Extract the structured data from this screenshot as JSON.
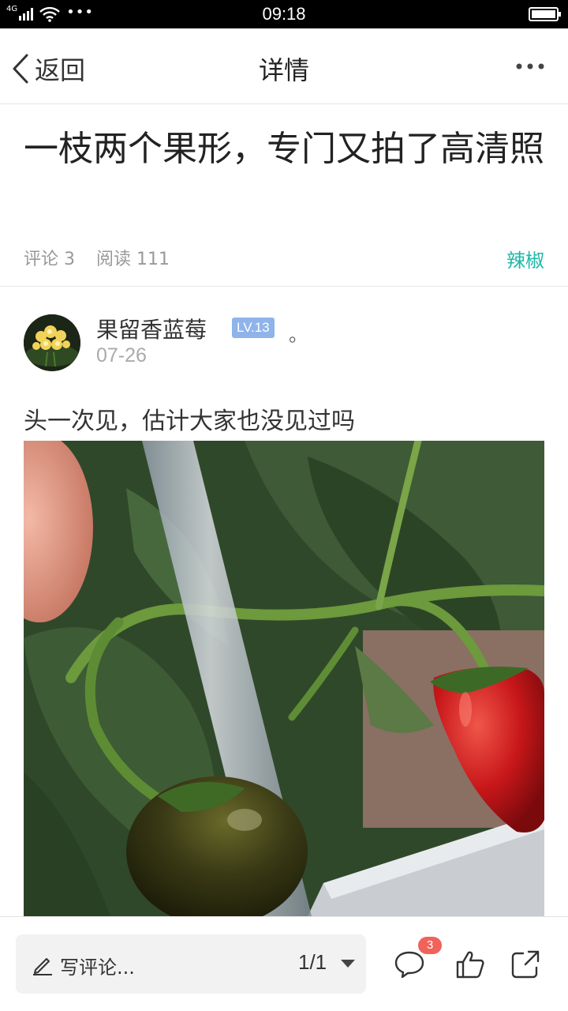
{
  "status_bar": {
    "network": "4G",
    "time": "09:18",
    "more_dots": "•••"
  },
  "nav": {
    "back_label": "返回",
    "title": "详情"
  },
  "post": {
    "title": "一枝两个果形，专门又拍了高清照",
    "comments_label": "评论 3",
    "reads_label": "阅读 111",
    "tag": "辣椒",
    "author": {
      "name": "果留香蓝莓",
      "level": "LV.13",
      "suffix": "。",
      "date": "07-26"
    },
    "text": "头一次见，估计大家也没见过吗"
  },
  "bottom_bar": {
    "comment_placeholder": "写评论...",
    "pager": "1/1",
    "comment_badge": "3"
  },
  "icons": [
    "back-chevron-icon",
    "more-icon",
    "pencil-icon",
    "dropdown-caret-icon",
    "comment-icon",
    "like-icon",
    "share-icon"
  ],
  "colors": {
    "tag": "#1fb8a8",
    "level_badge": "#8fb4ea",
    "notification_badge": "#f0625a"
  }
}
